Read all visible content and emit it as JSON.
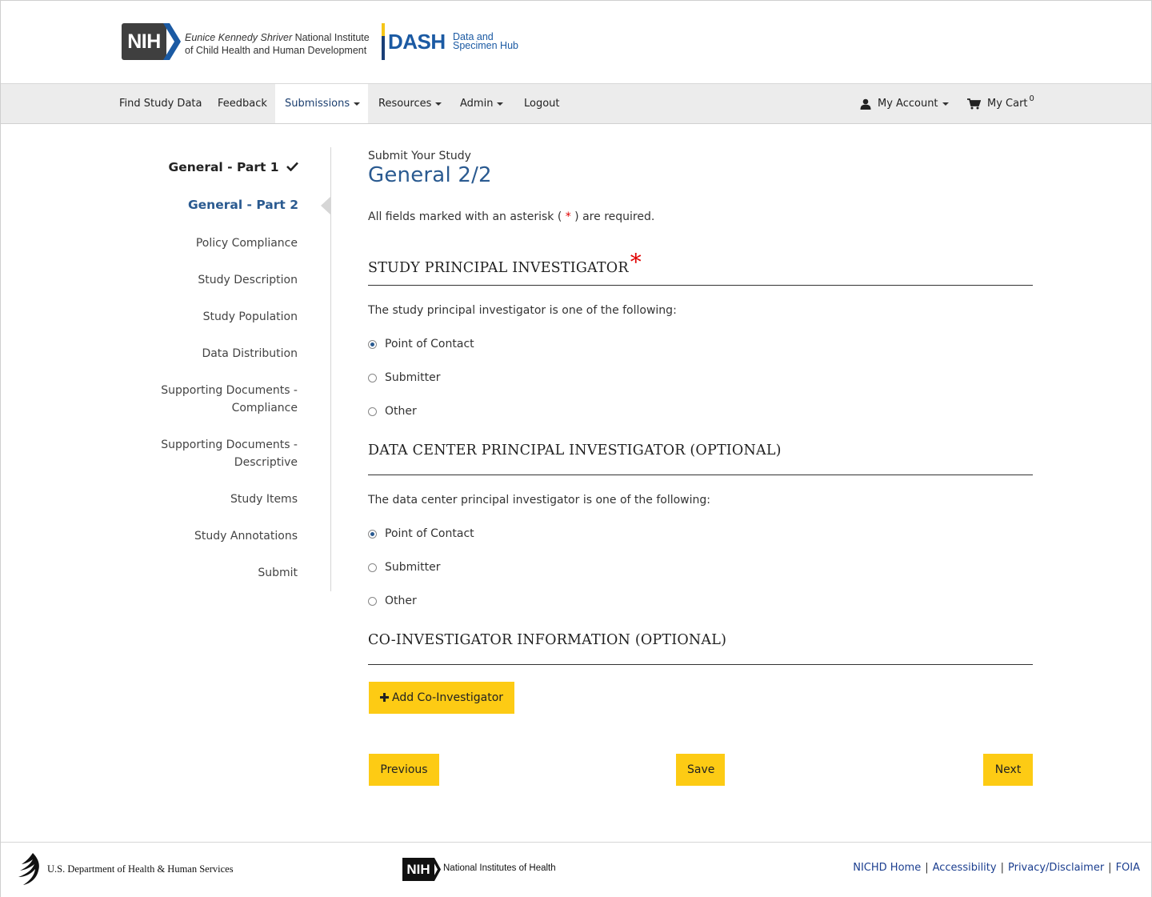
{
  "header": {
    "nih_logo_text": "NIH",
    "institute_line1_italic": "Eunice Kennedy Shriver",
    "institute_line1_rest": " National Institute",
    "institute_line2": "of Child Health and Human Development",
    "dash_word": "DASH",
    "dash_sub1": "Data and",
    "dash_sub2": "Specimen Hub"
  },
  "nav": {
    "find_study_data": "Find Study Data",
    "feedback": "Feedback",
    "submissions": "Submissions",
    "resources": "Resources",
    "admin": "Admin",
    "logout": "Logout",
    "my_account": "My Account",
    "my_cart": "My Cart",
    "cart_count": "0"
  },
  "sidebar": {
    "items": [
      {
        "label": "General - Part 1"
      },
      {
        "label": "General - Part 2"
      },
      {
        "label": "Policy Compliance"
      },
      {
        "label": "Study Description"
      },
      {
        "label": "Study Population"
      },
      {
        "label": "Data Distribution"
      },
      {
        "label": "Supporting Documents -",
        "label2": "Compliance"
      },
      {
        "label": "Supporting Documents -",
        "label2": "Descriptive"
      },
      {
        "label": "Study Items"
      },
      {
        "label": "Study Annotations"
      },
      {
        "label": "Submit"
      }
    ]
  },
  "main": {
    "subtitle": "Submit Your Study",
    "title": "General 2/2",
    "required_note_before": "All fields marked with an asterisk ( ",
    "required_star": "*",
    "required_note_after": " ) are required.",
    "sections": [
      {
        "title": "STUDY PRINCIPAL INVESTIGATOR",
        "star": "*",
        "prompt": "The study principal investigator is one of the following:",
        "options": [
          "Point of Contact",
          "Submitter",
          "Other"
        ],
        "selected": "Point of Contact"
      },
      {
        "title": "DATA CENTER PRINCIPAL INVESTIGATOR (OPTIONAL)",
        "prompt": "The data center principal investigator is one of the following:",
        "options": [
          "Point of Contact",
          "Submitter",
          "Other"
        ],
        "selected": "Point of Contact"
      },
      {
        "title": "CO-INVESTIGATOR INFORMATION (OPTIONAL)"
      }
    ],
    "add_co_investigator": "Add Co-Investigator",
    "previous": "Previous",
    "save": "Save",
    "next": "Next"
  },
  "footer": {
    "hhs": "U.S. Department of Health & Human Services",
    "nih_logo_text": "NIH",
    "nih_name": "National Institutes of Health",
    "links": [
      "NICHD Home",
      "Accessibility",
      "Privacy/Disclaimer",
      "FOIA"
    ]
  },
  "colors": {
    "accent_blue": "#2a5a90",
    "button_yellow": "#fdcb14",
    "nav_bg": "#ececec",
    "required_red": "#e00000"
  }
}
